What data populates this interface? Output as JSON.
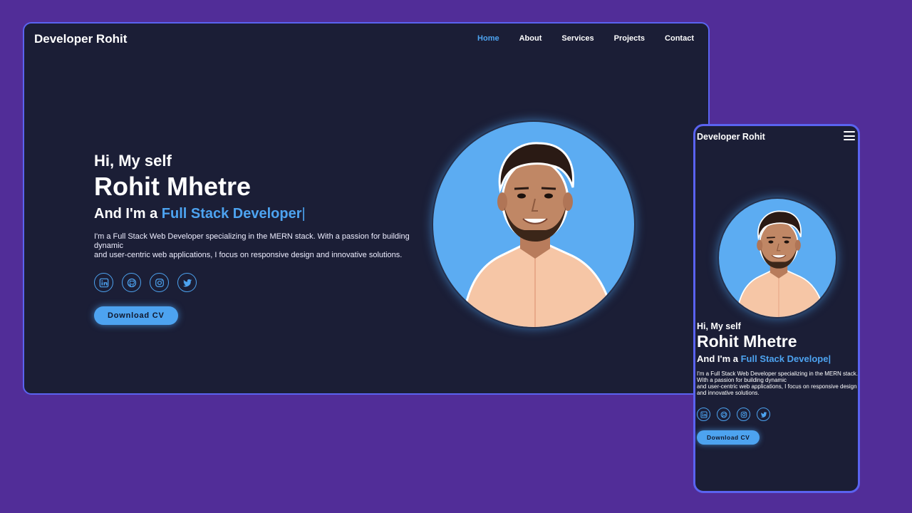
{
  "brand": "Developer Rohit",
  "nav": {
    "items": [
      {
        "label": "Home",
        "active": true
      },
      {
        "label": "About",
        "active": false
      },
      {
        "label": "Services",
        "active": false
      },
      {
        "label": "Projects",
        "active": false
      },
      {
        "label": "Contact",
        "active": false
      }
    ]
  },
  "hero": {
    "greeting": "Hi, My self",
    "name": "Rohit Mhetre",
    "role_prefix": "And I'm a ",
    "role_desktop": "Full Stack Developer",
    "role_mobile": "Full Stack Develope",
    "cursor": "|",
    "description_line1": "I'm a Full Stack Web Developer specializing in the MERN stack. With a passion for building dynamic",
    "description_line2": "and user-centric web applications, I focus on responsive design and innovative solutions.",
    "mobile_description_line1": "I'm a Full Stack Web Developer specializing in the MERN stack. With a passion for building dynamic",
    "mobile_description_line2": "and user-centric web applications, I focus on responsive design and innovative solutions.",
    "cv_button": "Download CV"
  },
  "socials": [
    {
      "icon": "linkedin-icon"
    },
    {
      "icon": "github-icon"
    },
    {
      "icon": "instagram-icon"
    },
    {
      "icon": "twitter-icon"
    }
  ],
  "colors": {
    "background": "#512d98",
    "card": "#1b1e36",
    "border": "#5a63f0",
    "accent": "#4da3f0"
  }
}
